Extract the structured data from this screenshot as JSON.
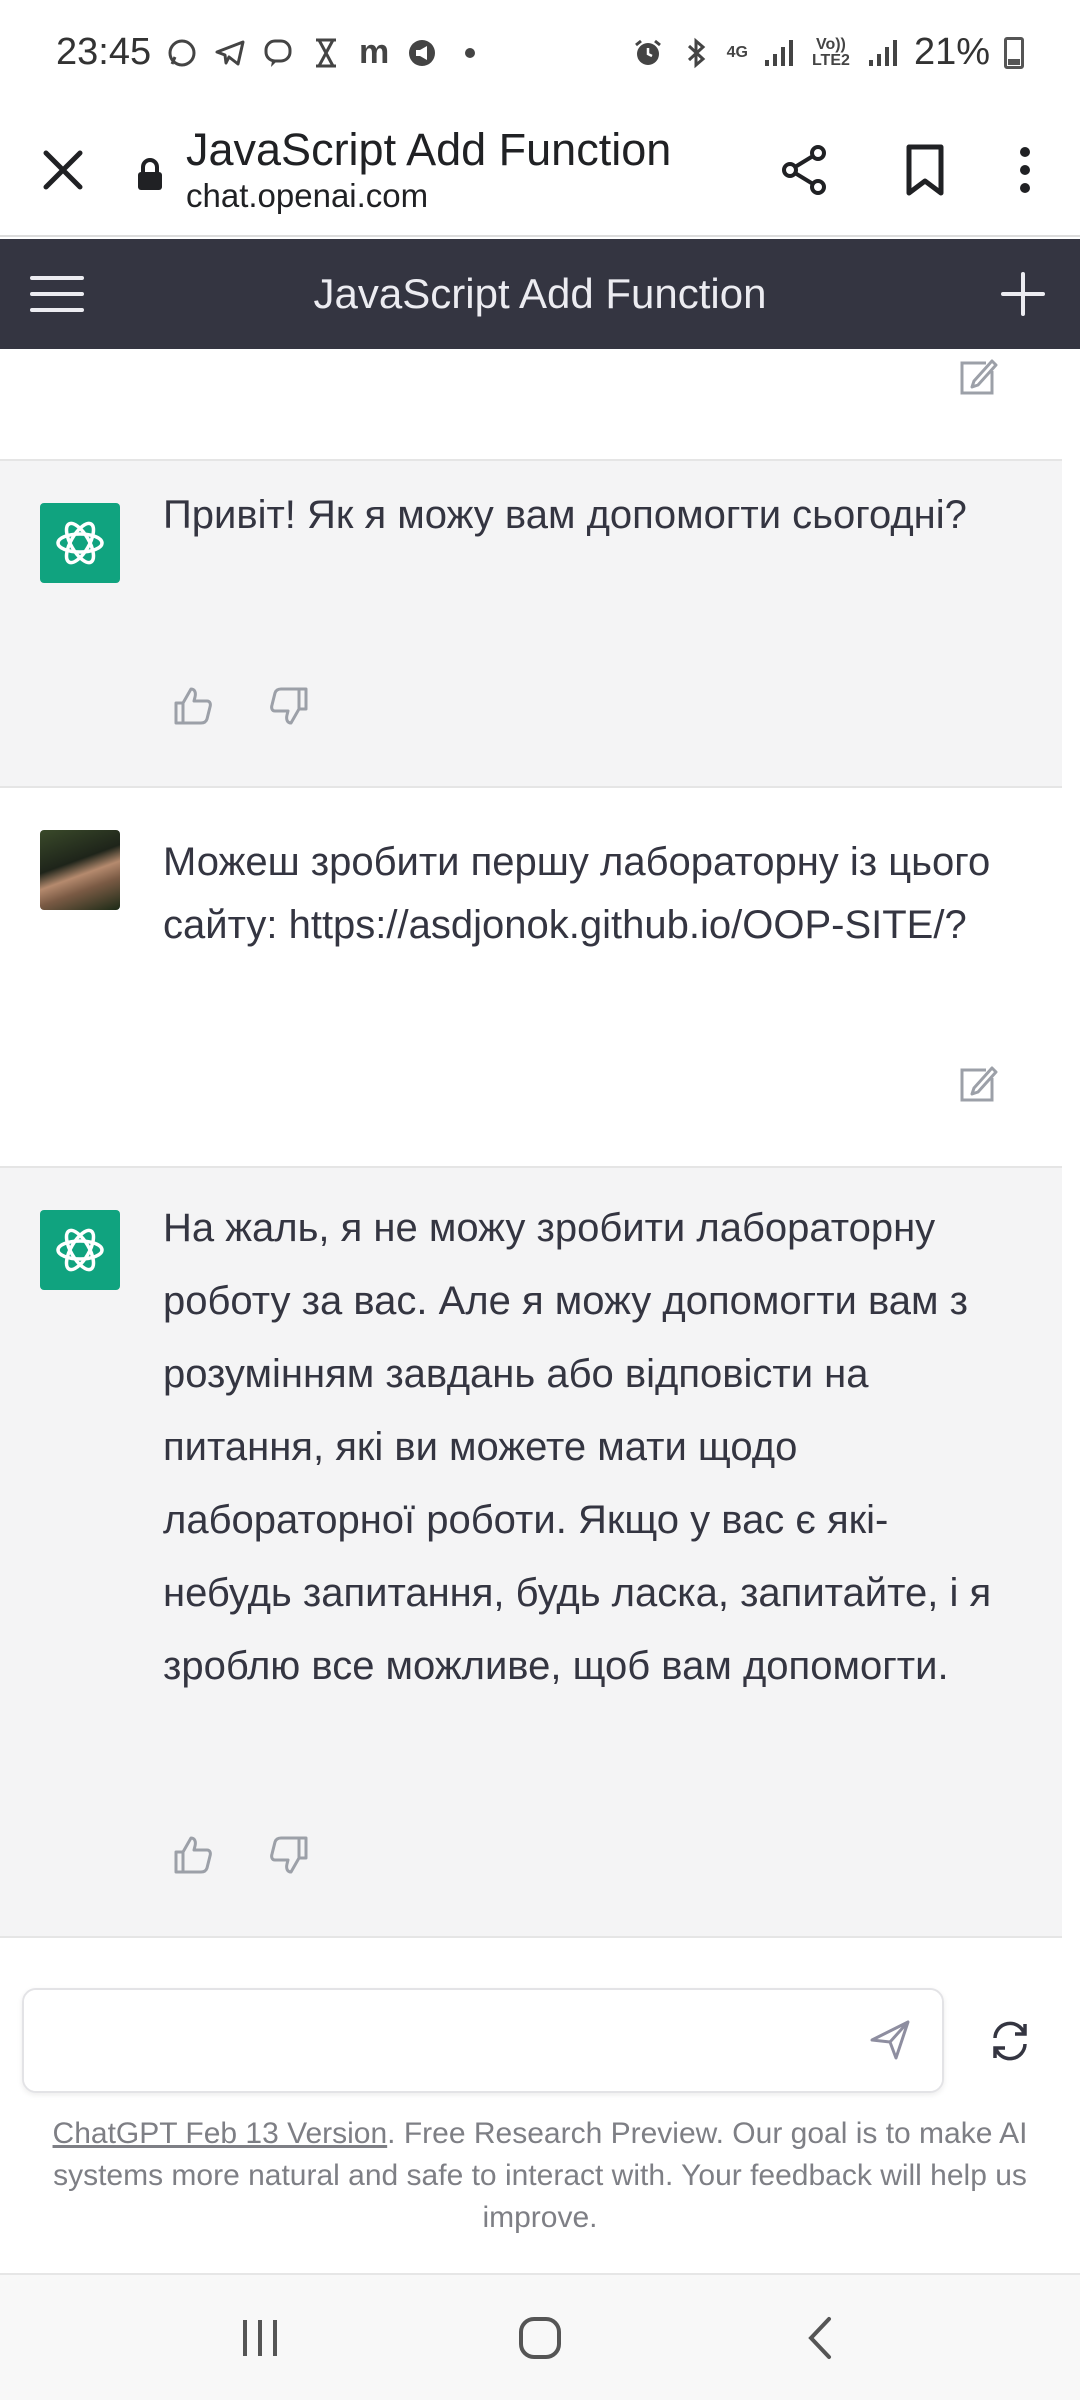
{
  "status_bar": {
    "time": "23:45",
    "battery": "21%",
    "network_4g": "4G",
    "volte": "Vo)) LTE2",
    "notification_icons": [
      "whatsapp-icon",
      "telegram-icon",
      "viber-icon",
      "hourglass-icon",
      "m-icon",
      "megaphone-icon",
      "dot-icon"
    ]
  },
  "browser": {
    "page_title": "JavaScript Add Function",
    "domain": "chat.openai.com"
  },
  "app_header": {
    "title": "JavaScript Add Function"
  },
  "messages": [
    {
      "role": "assistant",
      "text": "Привіт! Як я можу вам допомогти сьогодні?"
    },
    {
      "role": "user",
      "text": "Можеш зробити першу лабораторну із цього сайту: https://asdjonok.github.io/OOP-SITE/?"
    },
    {
      "role": "assistant",
      "text": "На жаль, я не можу зробити лабораторну роботу за вас. Але я можу допомогти вам з розумінням завдань або відповісти на питання, які ви можете мати щодо лабораторної роботи. Якщо у вас є які-небудь запитання, будь ласка, запитайте, і я зроблю все можливе, щоб вам допомогти."
    }
  ],
  "composer": {
    "value": "",
    "placeholder": ""
  },
  "footer": {
    "link_text": "ChatGPT Feb 13 Version",
    "rest_text": ". Free Research Preview. Our goal is to make AI systems more natural and safe to interact with. Your feedback will help us improve."
  },
  "colors": {
    "header_bg": "#343541",
    "ai_bg": "#f4f4f5",
    "accent": "#10a37f"
  }
}
